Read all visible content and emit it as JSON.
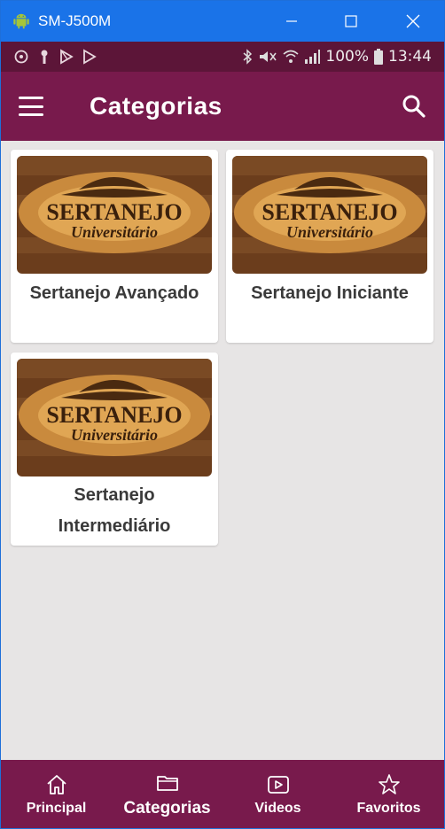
{
  "window": {
    "title": "SM-J500M"
  },
  "status_bar": {
    "left_icons": [
      "sync-icon",
      "key-icon",
      "play-store-icon",
      "play-icon"
    ],
    "right_icons": [
      "bluetooth-icon",
      "mute-icon",
      "wifi-icon",
      "signal-icon"
    ],
    "battery": "100%",
    "time": "13:44"
  },
  "app_bar": {
    "title": "Categorias"
  },
  "cards": [
    {
      "label": "Sertanejo Avançado",
      "image": {
        "line1": "SERTANEJO",
        "line2": "Universitário"
      }
    },
    {
      "label": "Sertanejo Iniciante",
      "image": {
        "line1": "SERTANEJO",
        "line2": "Universitário"
      }
    },
    {
      "label_line1": "Sertanejo",
      "label_line2": "Intermediário",
      "image": {
        "line1": "SERTANEJO",
        "line2": "Universitário"
      }
    }
  ],
  "bottom_nav": [
    {
      "label": "Principal",
      "icon": "home-icon"
    },
    {
      "label": "Categorias",
      "icon": "folder-icon"
    },
    {
      "label": "Videos",
      "icon": "video-icon"
    },
    {
      "label": "Favoritos",
      "icon": "star-icon"
    }
  ],
  "colors": {
    "primary": "#781a4c",
    "status_bar": "#5c1538",
    "background": "#e7e5e5",
    "titlebar": "#1a73e8"
  }
}
